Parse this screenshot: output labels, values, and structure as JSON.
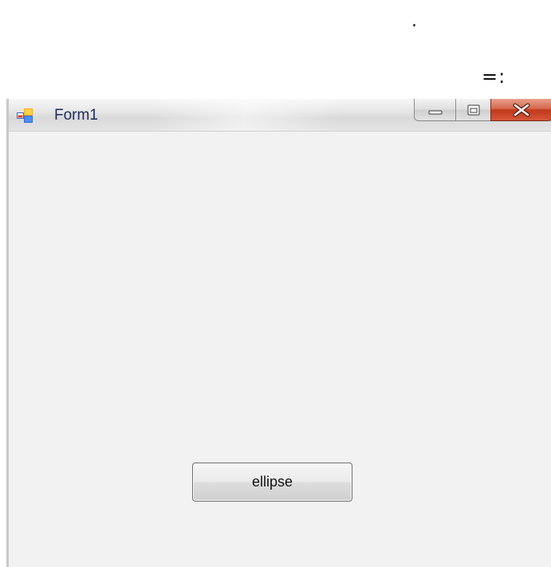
{
  "background_marks": {
    "dot": ".",
    "symbols": "=:"
  },
  "window": {
    "title": "Form1",
    "icon": "winforms-app-icon",
    "caption_buttons": {
      "minimize_icon": "minimize-icon",
      "maximize_icon": "maximize-icon",
      "close_label": "X"
    },
    "close_color": "#c0391b"
  },
  "form": {
    "button_label": "ellipse"
  }
}
